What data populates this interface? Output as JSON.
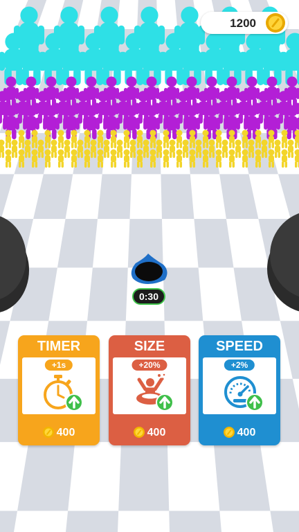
{
  "hud": {
    "coins": "1200",
    "coin_icon": "gold-coin-icon"
  },
  "hole": {
    "timer": "0:30"
  },
  "colors": {
    "timer_card": "#f7a51c",
    "size_card": "#dc5f43",
    "speed_card": "#1f8fd1",
    "crowd_cyan": "#2ee0e6",
    "crowd_purple": "#b31fd6",
    "crowd_yellow": "#f3d52a",
    "timer_accent": "#3fc34a"
  },
  "upgrades": [
    {
      "title": "TIMER",
      "bonus": "+1s",
      "price": "400",
      "icon": "stopwatch-icon"
    },
    {
      "title": "SIZE",
      "bonus": "+20%",
      "price": "400",
      "icon": "size-figure-icon"
    },
    {
      "title": "SPEED",
      "bonus": "+2%",
      "price": "400",
      "icon": "speedometer-icon"
    }
  ]
}
